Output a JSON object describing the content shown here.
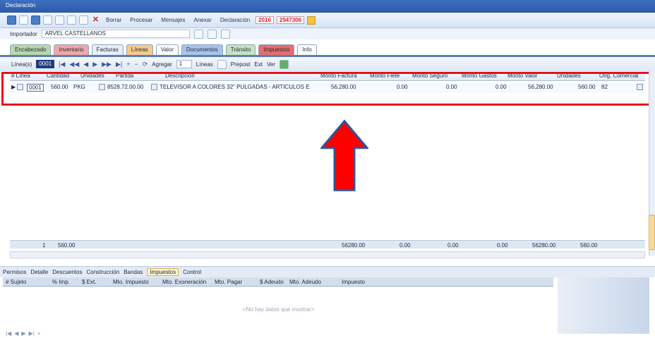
{
  "window": {
    "title": "Declaración"
  },
  "toolbar": {
    "borrar": "Borrar",
    "procesar": "Procesar",
    "mensajes": "Mensajes",
    "anexar": "Anexar",
    "declaracion_label": "Declaración",
    "declaracion_year": "2016",
    "declaracion_num": "2947306"
  },
  "importer": {
    "label": "Importador",
    "value": "ARVEL CASTELLANOS"
  },
  "tabs": [
    {
      "label": "Encabezado",
      "color": "#b9d7a8"
    },
    {
      "label": "Inventario",
      "color": "#f2a7a7"
    },
    {
      "label": "Facturas",
      "color": "#e8edf6"
    },
    {
      "label": "Líneas",
      "color": "#f7c98b"
    },
    {
      "label": "Valor",
      "color": "#ffffff"
    },
    {
      "label": "Documentos",
      "color": "#a9c4e8"
    },
    {
      "label": "Tránsito",
      "color": "#c6e3c0"
    },
    {
      "label": "Impuestos",
      "color": "#e66d6d"
    },
    {
      "label": "Info",
      "color": "#ffffff"
    }
  ],
  "nav": {
    "lineas_label": "Línea(s)",
    "record": "0001",
    "agregar_label": "Agregar",
    "agregar_value": "1",
    "lineas2": "Líneas",
    "prepost": "Prepost",
    "ext": "Ext",
    "ver": "Ver"
  },
  "grid": {
    "headers": [
      "# Línea",
      "Cantidad",
      "Unidades",
      "Partida",
      "Descripción",
      "Monto Factura",
      "Monto Flete",
      "Monto Seguro",
      "Monto Gastos",
      "Monto Valor",
      "Unidades",
      "Orig. Comercial"
    ],
    "row": {
      "line": "0001",
      "cantidad": "560.00",
      "unidad": "PKG",
      "partida": "8528.72.00.00",
      "descripcion": "TELEVISOR A COLORES 32\" PULGADAS - ARTICULOS E",
      "monto_factura": "56,280.00",
      "monto_flete": "0.00",
      "monto_seguro": "0.00",
      "monto_gastos": "0.00",
      "monto_valor": "56,280.00",
      "unidades": "560.00",
      "orig": "82"
    },
    "totals": {
      "count": "1",
      "cantidad": "560.00",
      "monto_factura": "56280.00",
      "monto_flete": "0.00",
      "monto_seguro": "0.00",
      "monto_gastos": "0.00",
      "monto_valor": "56280.00",
      "unidades": "560.00"
    }
  },
  "lower_tabs": [
    "Permisos",
    "Detalle",
    "Descuentos",
    "Construcción",
    "Bandas",
    "Impuestos",
    "Control"
  ],
  "lower_grid": {
    "headers": [
      "# Sujeto",
      "% Imp.",
      "$ Ext.",
      "Mto. Impuesto",
      "Mto. Exoneración",
      "Mto. Pagar",
      "$ Adeudo",
      "Mto. Adeudo",
      "Impuesto"
    ],
    "empty_text": "<No hay datos que mostrar>"
  },
  "colors": {
    "highlight": "#e3141b",
    "arrow_fill": "#ff0000",
    "arrow_stroke": "#2f5597"
  }
}
